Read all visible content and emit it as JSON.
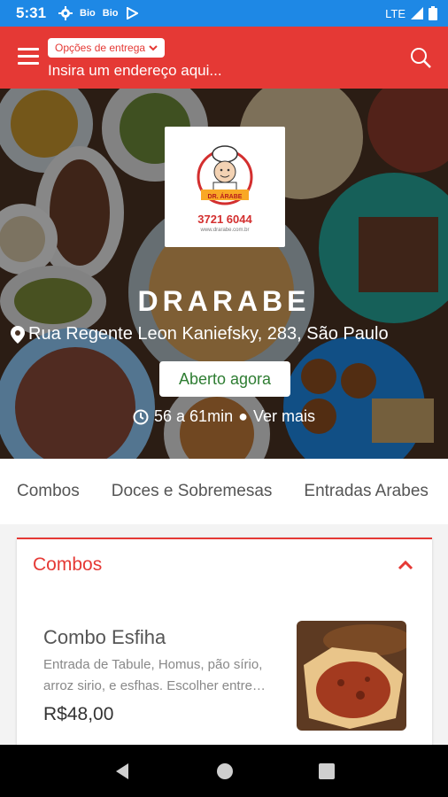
{
  "status_bar": {
    "time": "5:31",
    "notif_1": "Bio",
    "notif_2": "Bio",
    "network": "LTE"
  },
  "app_bar": {
    "delivery_options": "Opções de entrega",
    "address_placeholder": "Insira um endereço aqui..."
  },
  "store": {
    "logo_phone": "3721 6044",
    "logo_site": "www.drarabe.com.br",
    "logo_banner": "DR. ÁRABE",
    "name": "DRARABE",
    "address": "Rua Regente Leon Kaniefsky, 283, São Paulo",
    "status": "Aberto agora",
    "delivery_time": "56 a 61min",
    "see_more": "Ver mais"
  },
  "tabs": [
    "Combos",
    "Doces e Sobremesas",
    "Entradas Arabes"
  ],
  "section": {
    "title": "Combos",
    "products": [
      {
        "name": "Combo Esfiha",
        "description": "Entrada de Tabule, Homus, pão sírio, arroz sirio, e esfhas. Escolher entre…",
        "price": "R$48,00"
      }
    ]
  },
  "colors": {
    "primary_red": "#e53935",
    "status_blue": "#1e88e5",
    "open_green": "#2e7d32"
  }
}
